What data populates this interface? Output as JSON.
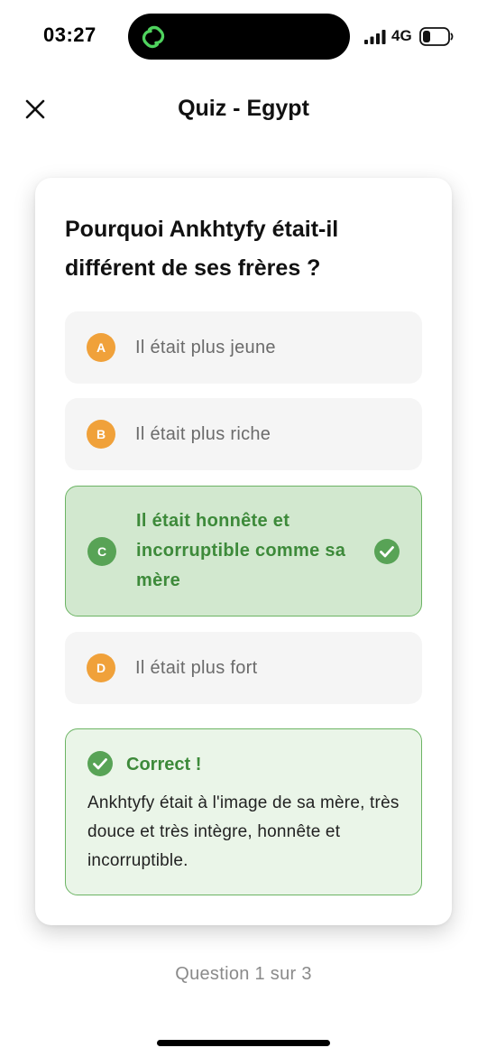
{
  "status_bar": {
    "time": "03:27",
    "network": "4G",
    "island_icon": "link-icon",
    "signal_icon": "signal-bars-icon",
    "battery_icon": "battery-low-icon"
  },
  "header": {
    "title": "Quiz - Egypt",
    "close_icon": "close-icon"
  },
  "question": "Pourquoi Ankhtyfy était-il différent de ses frères ?",
  "options": [
    {
      "letter": "A",
      "text": "Il était plus jeune",
      "state": "default"
    },
    {
      "letter": "B",
      "text": "Il était plus riche",
      "state": "default"
    },
    {
      "letter": "C",
      "text": "Il était honnête et incorruptible comme sa mère",
      "state": "correct"
    },
    {
      "letter": "D",
      "text": "Il était plus fort",
      "state": "default"
    }
  ],
  "feedback": {
    "title": "Correct !",
    "text": "Ankhtyfy était à l'image de sa mère, très douce et très intègre, honnête et incorruptible."
  },
  "progress": "Question 1 sur 3",
  "colors": {
    "badge_default": "#f0a13a",
    "correct_green": "#58a356",
    "correct_bg": "#d2e8cf",
    "feedback_bg": "#eaf5e8",
    "island_icon": "#4fd35e"
  }
}
